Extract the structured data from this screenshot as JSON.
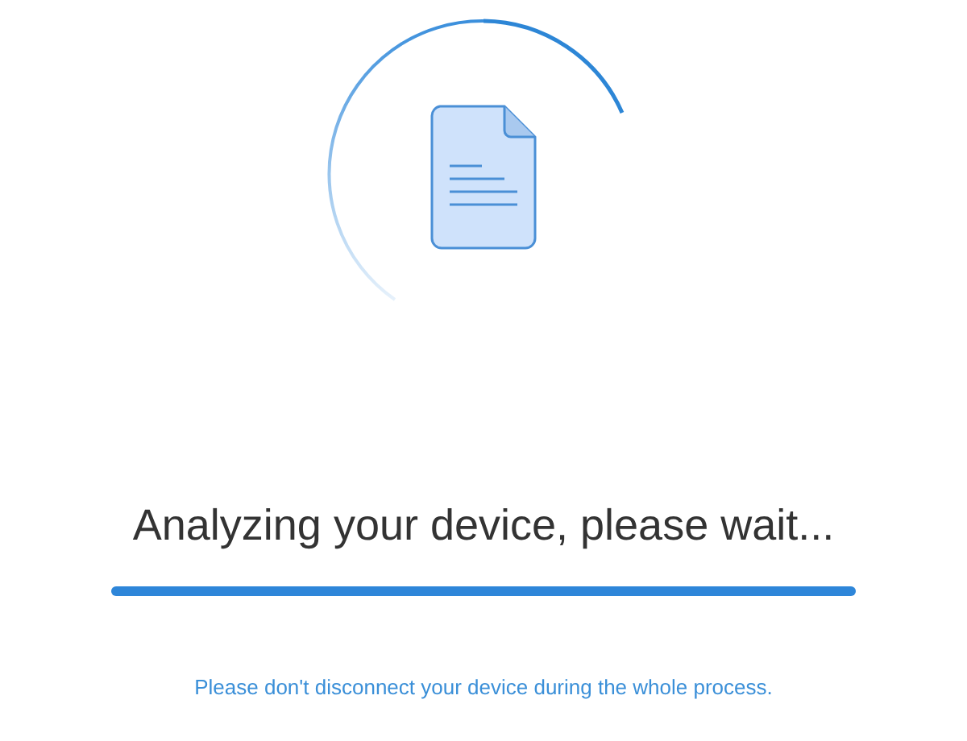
{
  "status": {
    "title": "Analyzing your device, please wait..."
  },
  "progress": {
    "level": 1
  },
  "notice": "Please don't disconnect your device during the whole process."
}
